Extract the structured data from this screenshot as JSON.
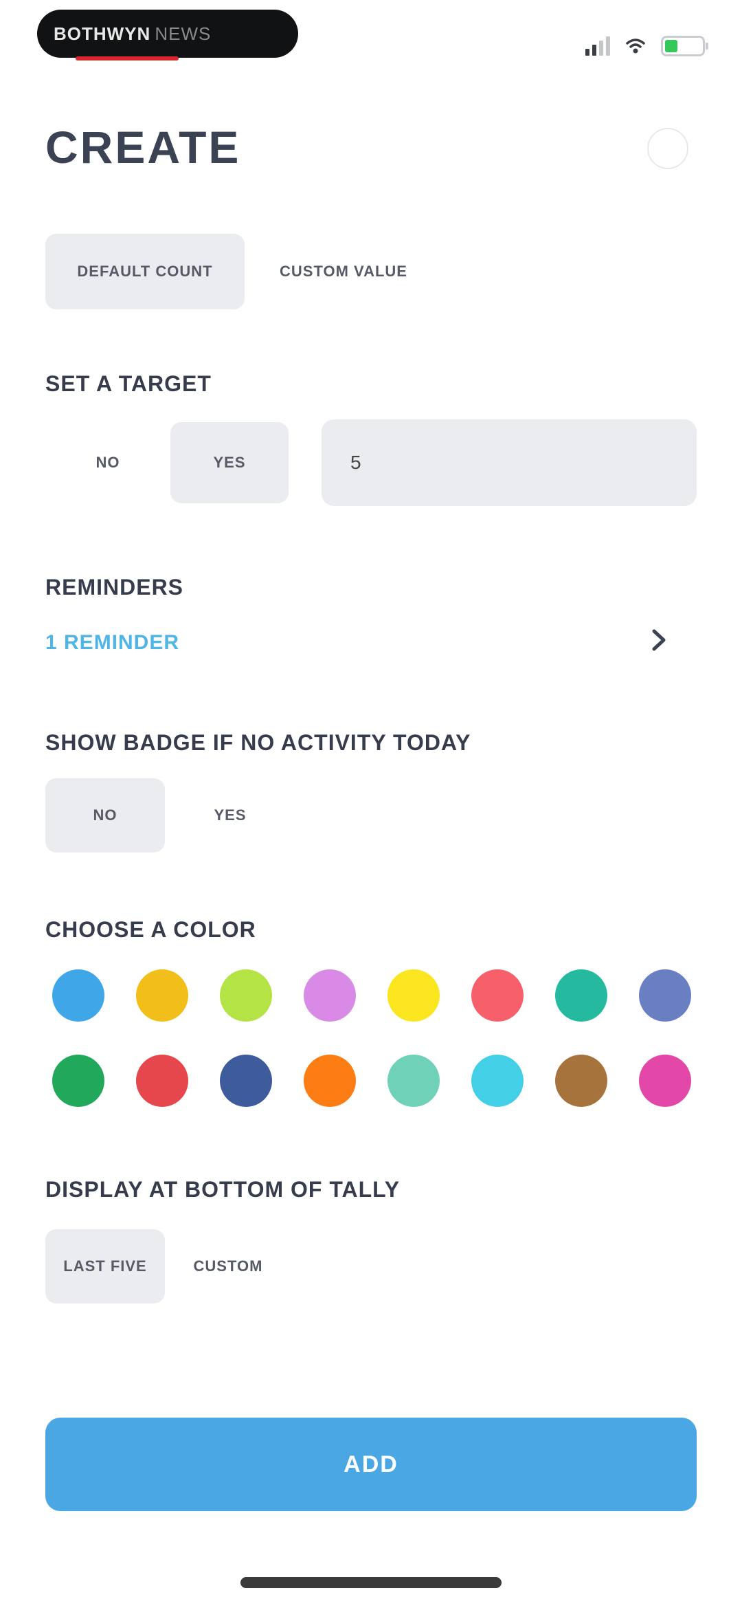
{
  "status_bar": {
    "pill_text_bold": "BOTHWYN",
    "pill_text_dim": "NEWS",
    "icons": [
      "signal-icon",
      "wifi-icon",
      "battery-icon"
    ]
  },
  "header": {
    "title": "CREATE",
    "help_icon": "circle-icon"
  },
  "mode_tabs": [
    {
      "label": "DEFAULT COUNT",
      "selected": true
    },
    {
      "label": "CUSTOM VALUE",
      "selected": false
    }
  ],
  "target": {
    "label": "SET A TARGET",
    "options": [
      {
        "label": "NO",
        "selected": false
      },
      {
        "label": "YES",
        "selected": true
      }
    ],
    "input_value": "5"
  },
  "reminders": {
    "label": "REMINDERS",
    "link": "1 REMINDER",
    "icon": "chevron-right-icon"
  },
  "badge": {
    "label": "SHOW BADGE IF NO ACTIVITY TODAY",
    "options": [
      {
        "label": "NO",
        "selected": true
      },
      {
        "label": "YES",
        "selected": false
      }
    ]
  },
  "colors": {
    "label": "CHOOSE A COLOR",
    "swatches": [
      "#3fa6e8",
      "#f2be1a",
      "#b4e345",
      "#d98ae6",
      "#fbe51f",
      "#f7606a",
      "#25b9a0",
      "#6a7fc2",
      "#22a85a",
      "#e5474c",
      "#3e5b9c",
      "#fb7d13",
      "#6fd1b8",
      "#43cfe6",
      "#a6733c",
      "#e348a8"
    ]
  },
  "display": {
    "label": "DISPLAY AT BOTTOM OF TALLY",
    "options": [
      {
        "label": "LAST FIVE",
        "selected": true
      },
      {
        "label": "CUSTOM",
        "selected": false
      }
    ]
  },
  "add_button": {
    "label": "ADD"
  }
}
